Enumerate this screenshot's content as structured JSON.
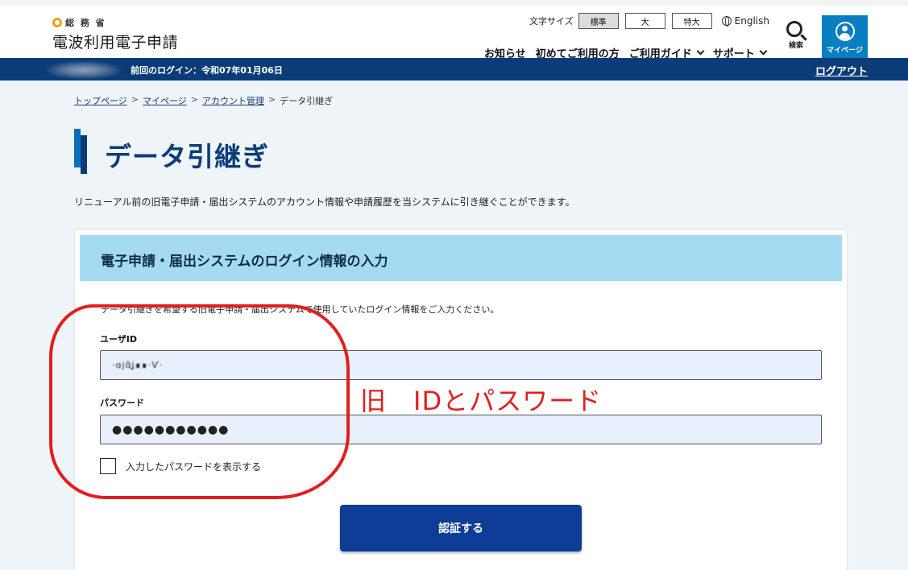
{
  "header": {
    "ministry": "総 務 省",
    "site_name": "電波利用電子申請",
    "font_size_label": "文字サイズ",
    "font_sizes": [
      "標準",
      "大",
      "特大"
    ],
    "language": "English",
    "nav": [
      "お知らせ",
      "初めてご利用の方",
      "ご利用ガイド",
      "サポート"
    ],
    "search_label": "検索",
    "mypage_label": "マイページ"
  },
  "login_bar": {
    "last_login": "前回のログイン：令和07年01月06日",
    "logout": "ログアウト"
  },
  "breadcrumb": [
    "トップページ",
    "マイページ",
    "アカウント管理",
    "データ引継ぎ"
  ],
  "page": {
    "title": "データ引継ぎ",
    "description": "リニューアル前の旧電子申請・届出システムのアカウント情報や申請履歴を当システムに引き継ぐことができます。"
  },
  "form": {
    "heading": "電子申請・届出システムのログイン情報の入力",
    "instruction": "データ引継ぎを希望する旧電子申請・届出システムで使用していたログイン情報をご入力ください。",
    "user_id_label": "ユーザID",
    "user_id_value": "·ɑjɑ̃ʝ∎∎·Ѵ·",
    "password_label": "パスワード",
    "password_value": "●●●●●●●●●●●",
    "show_password_label": "入力したパスワードを表示する",
    "submit_label": "認証する"
  },
  "annotation": {
    "text": "旧　IDとパスワード",
    "color": "#e21e1e"
  },
  "colors": {
    "navy": "#0b3c78",
    "accent_blue": "#0a7ec2",
    "form_header": "#a5dbf2",
    "button": "#0d3d96"
  }
}
